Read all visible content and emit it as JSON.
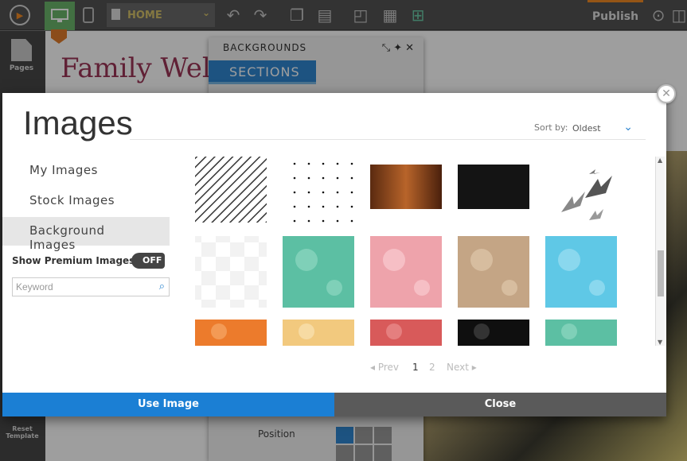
{
  "topbar": {
    "page_select": "HOME",
    "publish_label": "Publish",
    "icons": [
      "logo-icon",
      "desktop-icon",
      "mobile-icon",
      "undo-icon",
      "redo-icon",
      "copy-icon",
      "paste-icon",
      "preview-icon",
      "grid-icon",
      "layout-icon",
      "search-icon"
    ]
  },
  "leftbar": {
    "pages_label": "Pages",
    "reset_label": "Reset Template"
  },
  "site": {
    "title": "Family Welln"
  },
  "backgrounds_panel": {
    "title": "BACKGROUNDS",
    "tab_sections": "SECTIONS",
    "position_label": "Position"
  },
  "modal": {
    "title": "Images",
    "sort_label": "Sort by:",
    "sort_value": "Oldest",
    "nav": [
      "My Images",
      "Stock Images",
      "Background Images"
    ],
    "active_nav": "Background Images",
    "premium_label": "Show Premium Images:",
    "premium_toggle": "OFF",
    "search_placeholder": "Keyword",
    "pagination": {
      "prev": "Prev",
      "pages": [
        "1",
        "2"
      ],
      "current": "1",
      "next": "Next"
    },
    "use_button": "Use Image",
    "close_button": "Close",
    "thumbnails": [
      "diagonal-stripes",
      "dot-grid",
      "wood-brown",
      "dark-texture",
      "birds",
      "checker",
      "floral-teal",
      "floral-pink",
      "floral-tan",
      "floral-blue",
      "floral-orange",
      "floral-yellow",
      "floral-red",
      "floral-black",
      "floral-teal-2"
    ],
    "colors": {
      "accent": "#1b7fd4",
      "close_bg": "#5a5a5a"
    }
  }
}
